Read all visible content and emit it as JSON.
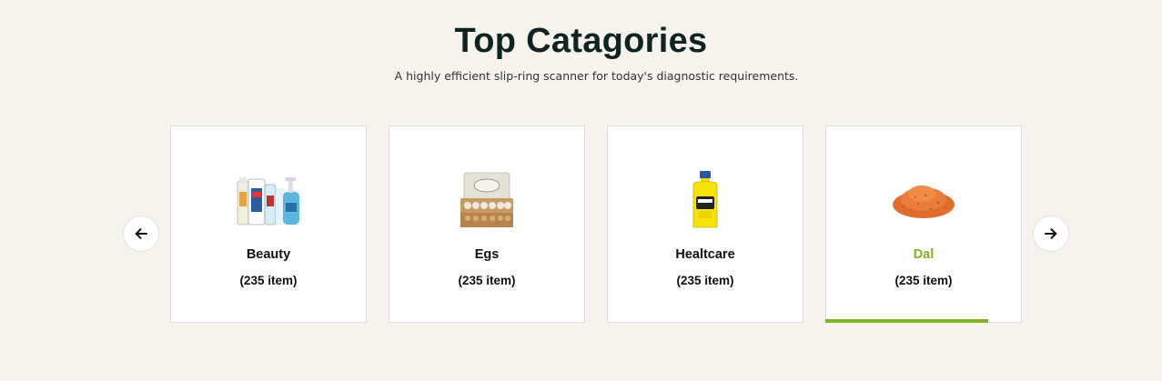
{
  "header": {
    "title": "Top Catagories",
    "subtitle": "A highly efficient slip-ring scanner for today's diagnostic requirements."
  },
  "carousel": {
    "prev_icon": "arrow-left-icon",
    "next_icon": "arrow-right-icon",
    "categories": [
      {
        "name": "Beauty",
        "count": "(235 item)",
        "image": "beauty-products-image",
        "active": false
      },
      {
        "name": "Egs",
        "count": "(235 item)",
        "image": "egg-carton-image",
        "active": false
      },
      {
        "name": "Healtcare",
        "count": "(235 item)",
        "image": "disinfectant-bottle-image",
        "active": false
      },
      {
        "name": "Dal",
        "count": "(235 item)",
        "image": "red-lentils-image",
        "active": true
      }
    ]
  },
  "colors": {
    "background": "#f5f3ec",
    "title": "#0f2422",
    "accent": "#82b127"
  }
}
